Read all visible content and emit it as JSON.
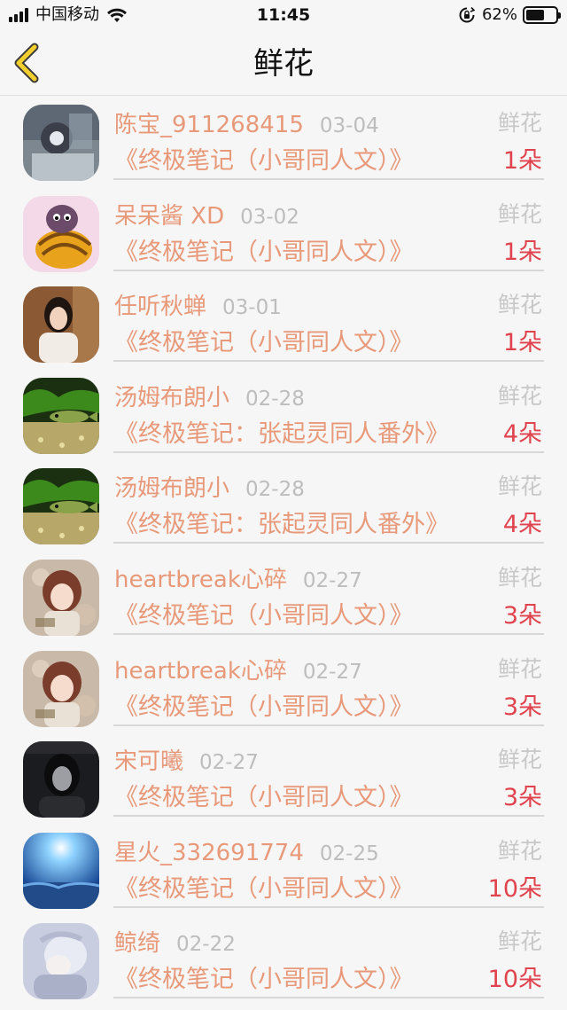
{
  "status_bar": {
    "carrier": "中国移动",
    "time": "11:45",
    "battery": "62%",
    "battery_level": 0.62,
    "icons": [
      "signal-icon",
      "wifi-icon",
      "orientation-lock-icon",
      "battery-icon"
    ]
  },
  "nav": {
    "back_icon": "chevron-left-icon",
    "title": "鲜花"
  },
  "colors": {
    "accent_text": "#e8997a",
    "count_red": "#e0434d",
    "back_yellow": "#f3cf2e"
  },
  "rows": [
    {
      "name": "陈宝_911268415",
      "date": "03-04",
      "type": "鲜花",
      "work": "《终极笔记（小哥同人文）》",
      "count": "1朵",
      "avatar": "avatar-selfie"
    },
    {
      "name": "呆呆酱 XD",
      "date": "03-02",
      "type": "鲜花",
      "work": "《终极笔记（小哥同人文）》",
      "count": "1朵",
      "avatar": "avatar-cartoon-turtle"
    },
    {
      "name": "任听秋蝉",
      "date": "03-01",
      "type": "鲜花",
      "work": "《终极笔记（小哥同人文）》",
      "count": "1朵",
      "avatar": "avatar-girl-photo"
    },
    {
      "name": "汤姆布朗小",
      "date": "02-28",
      "type": "鲜花",
      "work": "《终极笔记：张起灵同人番外》",
      "count": "4朵",
      "avatar": "avatar-fish-tank"
    },
    {
      "name": "汤姆布朗小",
      "date": "02-28",
      "type": "鲜花",
      "work": "《终极笔记：张起灵同人番外》",
      "count": "4朵",
      "avatar": "avatar-fish-tank"
    },
    {
      "name": "heartbreak心碎",
      "date": "02-27",
      "type": "鲜花",
      "work": "《终极笔记（小哥同人文）》",
      "count": "3朵",
      "avatar": "avatar-anime-girl"
    },
    {
      "name": "heartbreak心碎",
      "date": "02-27",
      "type": "鲜花",
      "work": "《终极笔记（小哥同人文）》",
      "count": "3朵",
      "avatar": "avatar-anime-girl"
    },
    {
      "name": "宋可曦",
      "date": "02-27",
      "type": "鲜花",
      "work": "《终极笔记（小哥同人文）》",
      "count": "3朵",
      "avatar": "avatar-dark-portrait"
    },
    {
      "name": "星火_332691774",
      "date": "02-25",
      "type": "鲜花",
      "work": "《终极笔记（小哥同人文）》",
      "count": "10朵",
      "avatar": "avatar-blue-sky"
    },
    {
      "name": "鲸绮",
      "date": "02-22",
      "type": "鲜花",
      "work": "《终极笔记（小哥同人文）》",
      "count": "10朵",
      "avatar": "avatar-pale-portrait"
    }
  ]
}
